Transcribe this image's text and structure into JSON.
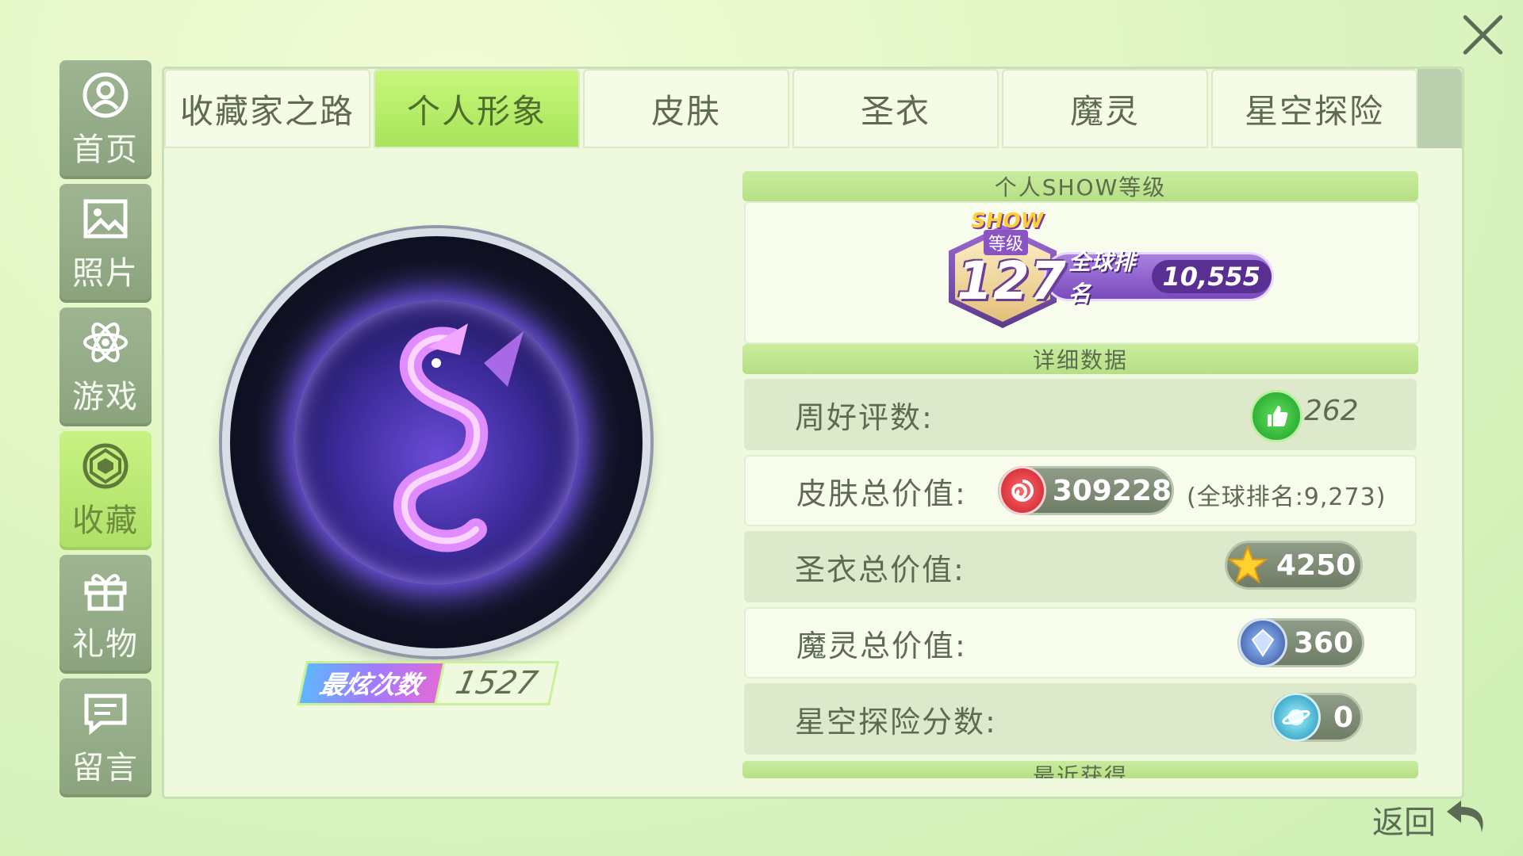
{
  "sidebar": {
    "items": [
      {
        "label": "首页",
        "icon": "user-circle-icon"
      },
      {
        "label": "照片",
        "icon": "image-icon"
      },
      {
        "label": "游戏",
        "icon": "atom-icon"
      },
      {
        "label": "收藏",
        "icon": "gem-icon"
      },
      {
        "label": "礼物",
        "icon": "gift-icon"
      },
      {
        "label": "留言",
        "icon": "chat-icon"
      }
    ],
    "active_index": 3
  },
  "tabs": [
    {
      "label": "收藏家之路"
    },
    {
      "label": "个人形象"
    },
    {
      "label": "皮肤"
    },
    {
      "label": "圣衣"
    },
    {
      "label": "魔灵"
    },
    {
      "label": "星空探险"
    }
  ],
  "active_tab_index": 1,
  "avatar": {
    "score_label": "最炫次数",
    "score_value": "1527"
  },
  "level_section": {
    "title": "个人SHOW等级",
    "badge_word": "SHOW",
    "badge_sub": "等级",
    "level": "127",
    "rank_label": "全球排名",
    "rank_value": "10,555"
  },
  "detail_section": {
    "title": "详细数据",
    "rows": [
      {
        "label": "周好评数:",
        "value": "262",
        "icon": "thumbs-up-icon"
      },
      {
        "label": "皮肤总价值:",
        "value": "309228",
        "icon": "swirl-coin-icon",
        "note": "(全球排名:9,273)"
      },
      {
        "label": "圣衣总价值:",
        "value": "4250",
        "icon": "star-icon"
      },
      {
        "label": "魔灵总价值:",
        "value": "360",
        "icon": "crystal-icon"
      },
      {
        "label": "星空探险分数:",
        "value": "0",
        "icon": "planet-icon"
      }
    ]
  },
  "recent_section": {
    "title": "最近获得"
  },
  "back_label": "返回",
  "colors": {
    "active_tab": "#b4ec6a",
    "sidebar_inactive": "#93ab86",
    "panel_bg": "#eef9dd",
    "section_head": "#bfe592"
  }
}
